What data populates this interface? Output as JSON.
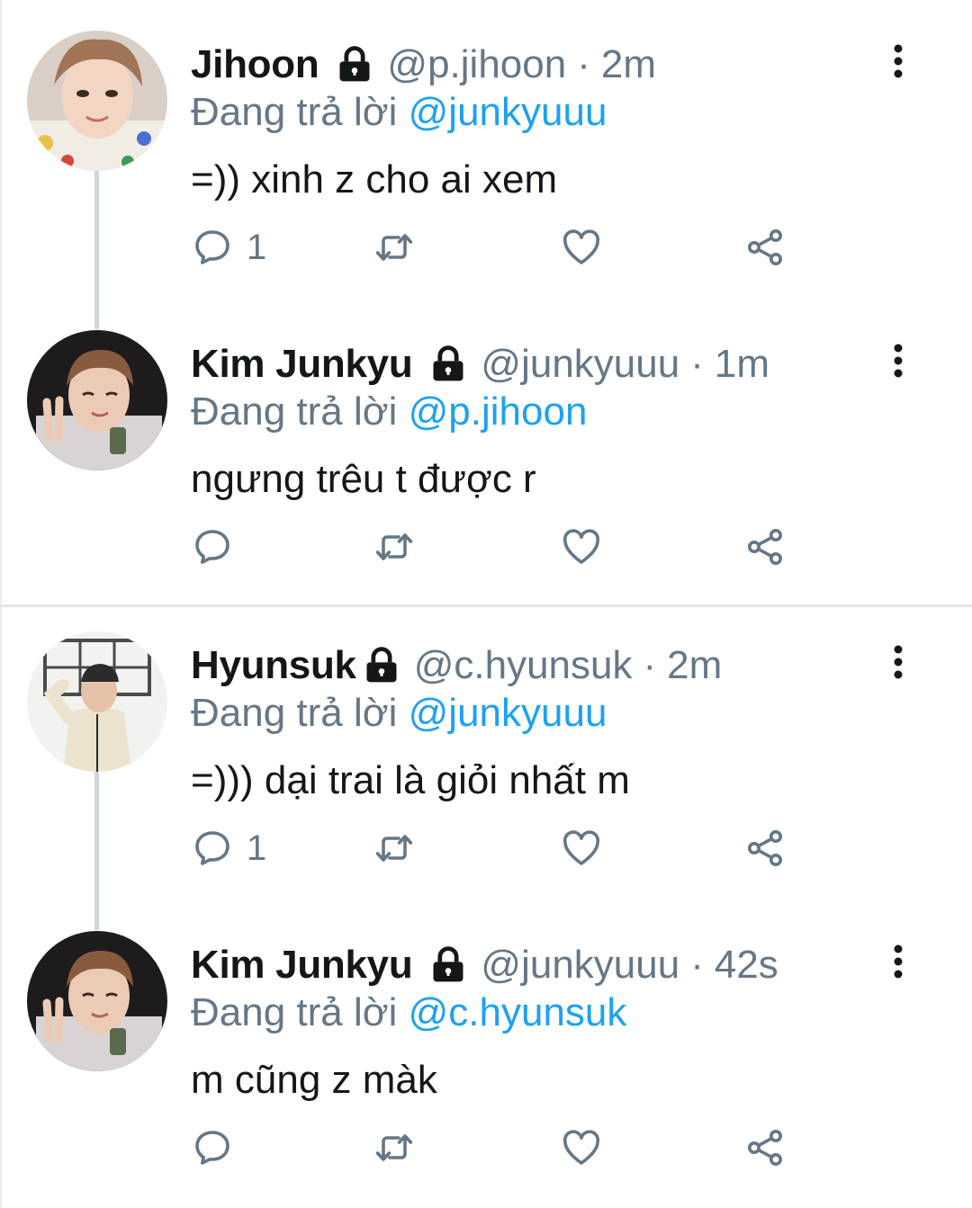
{
  "colors": {
    "text": "#14171a",
    "secondary": "#657786",
    "mention": "#1da1f2",
    "thread_line": "#cfd6db",
    "divider": "#e3e7ea"
  },
  "tweets": [
    {
      "name": "Jihoon",
      "handle": "@p.jihoon",
      "separator": "·",
      "time": "2m",
      "replying_prefix": "Đang trả lời",
      "replying_to": "@junkyuuu",
      "text": "=)) xinh z cho ai xem",
      "reply_count": "1",
      "avatar_icon": "avatar-photo"
    },
    {
      "name": "Kim Junkyu",
      "handle": "@junkyuuu",
      "separator": "·",
      "time": "1m",
      "replying_prefix": "Đang trả lời",
      "replying_to": "@p.jihoon",
      "text": "ngưng trêu t được r",
      "reply_count": "",
      "avatar_icon": "avatar-photo"
    },
    {
      "name": "Hyunsuk",
      "handle": "@c.hyunsuk",
      "separator": "·",
      "time": "2m",
      "replying_prefix": "Đang trả lời",
      "replying_to": "@junkyuuu",
      "text": "=))) dại trai là giỏi nhất m",
      "reply_count": "1",
      "avatar_icon": "avatar-photo"
    },
    {
      "name": "Kim Junkyu",
      "handle": "@junkyuuu",
      "separator": "·",
      "time": "42s",
      "replying_prefix": "Đang trả lời",
      "replying_to": "@c.hyunsuk",
      "text": "m cũng z màk",
      "reply_count": "",
      "avatar_icon": "avatar-photo"
    }
  ],
  "icons": {
    "lock": "lock-icon",
    "more": "more-vertical-icon",
    "reply": "reply-icon",
    "retweet": "retweet-icon",
    "like": "heart-icon",
    "share": "share-icon"
  }
}
